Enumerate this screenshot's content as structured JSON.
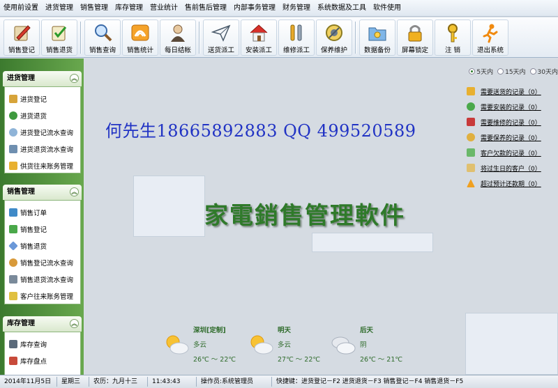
{
  "menu": [
    "使用前设置",
    "进货管理",
    "销售管理",
    "库存管理",
    "营业统计",
    "售前售后管理",
    "内部事务管理",
    "财务管理",
    "系统数据及工具",
    "软件使用"
  ],
  "toolbar": {
    "b1": {
      "label": "销售登记",
      "icon": "pen-notebook-icon"
    },
    "b2": {
      "label": "销售退货",
      "icon": "check-notebook-icon"
    },
    "b3": {
      "label": "销售查询",
      "icon": "magnifier-icon"
    },
    "b4": {
      "label": "销售统计",
      "icon": "chart-icon"
    },
    "b5": {
      "label": "每日结帐",
      "icon": "person-icon"
    },
    "b6": {
      "label": "送货派工",
      "icon": "paper-plane-icon"
    },
    "b7": {
      "label": "安装派工",
      "icon": "house-icon"
    },
    "b8": {
      "label": "维修派工",
      "icon": "tools-icon"
    },
    "b9": {
      "label": "保养维护",
      "icon": "maintenance-icon"
    },
    "b10": {
      "label": "数据备份",
      "icon": "folder-backup-icon"
    },
    "b11": {
      "label": "屏幕锁定",
      "icon": "padlock-icon"
    },
    "b12": {
      "label": "注 销",
      "icon": "key-icon"
    },
    "b13": {
      "label": "退出系统",
      "icon": "exit-runner-icon"
    }
  },
  "sidebar": {
    "purchase": {
      "title": "进货管理",
      "items": [
        "进货登记",
        "进货退货",
        "进货登记流水查询",
        "进货退货流水查询",
        "供货往来账务管理"
      ]
    },
    "sales": {
      "title": "销售管理",
      "items": [
        "销售订单",
        "销售登记",
        "销售退货",
        "销售登记流水查询",
        "销售退货流水查询",
        "客户往来账务管理"
      ]
    },
    "stock": {
      "title": "库存管理",
      "items": [
        "库存查询",
        "库存盘点"
      ]
    }
  },
  "main": {
    "contact": "何先生18665892883 QQ 499520589",
    "title": "家電銷售管理軟件"
  },
  "radios": {
    "options": [
      "5天内",
      "15天内",
      "30天内"
    ],
    "selected": "5天内"
  },
  "reminders": [
    "需要送货的记录（0）",
    "需要安装的记录（0）",
    "需要维修的记录（0）",
    "需要保养的记录（0）",
    "客户欠款的记录（0）",
    "将过生日的客户（0）",
    "超过预计还款期（0）"
  ],
  "weather": [
    {
      "label": "深圳[定制]",
      "cond": "多云",
      "temp": "26℃ ～ 22℃",
      "icon": "partly-cloudy-icon"
    },
    {
      "label": "明天",
      "cond": "多云",
      "temp": "27℃ ～ 22℃",
      "icon": "partly-cloudy-icon"
    },
    {
      "label": "后天",
      "cond": "阴",
      "temp": "26℃ ～ 21℃",
      "icon": "overcast-icon"
    }
  ],
  "status": {
    "date": "2014年11月5日",
    "weekday": "星期三",
    "lunar": "农历：九月十三",
    "time": "11:43:43",
    "operator": "操作员:系统管理员",
    "shortcuts": "快捷键：进货登记－F2 进货退货－F3 销售登记－F4 销售退货－F5"
  },
  "colors": {
    "sidebar_green": "#4f8f3c",
    "contact_blue": "#2133c4",
    "title_green": "#2f7a2a"
  }
}
